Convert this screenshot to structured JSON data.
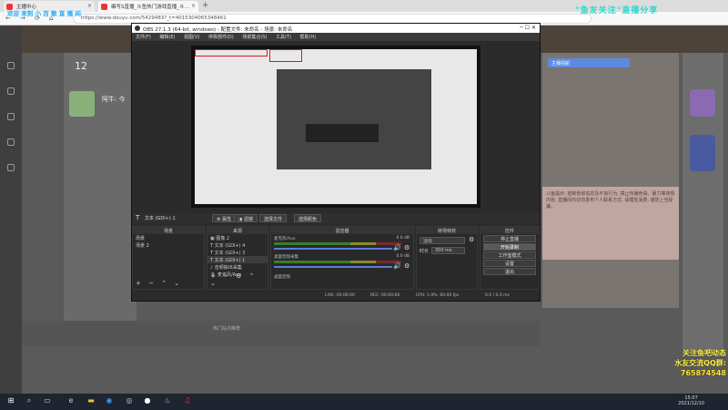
{
  "browser": {
    "tabs": [
      {
        "label": "主播中心",
        "active": false
      },
      {
        "label": "编写S直播_斗鱼热门游戏直播_斗…",
        "active": true
      }
    ],
    "url": "https://www.douyu.com/5429483?_t=4015304065348461"
  },
  "watermarks": {
    "top_left": "欢迎 来到 小 百 歌 直 播 间",
    "top_right": "\"鱼友关注\"直播分享"
  },
  "obs": {
    "title": "OBS 27.1.3 (64-bit, windows) - 配置文件: 未命名 - 场景: 未命名",
    "menu": [
      "文件(F)",
      "编辑(E)",
      "视图(V)",
      "停靠部件(D)",
      "场景集合(S)",
      "工具(T)",
      "帮助(H)"
    ],
    "source_toolbar": {
      "selected_source": "文本 (GDI+) 1",
      "buttons": [
        "属性",
        "滤镜",
        "选择文件",
        "选择颜色"
      ]
    },
    "docks": {
      "scenes": {
        "title": "场景",
        "items": [
          "场景",
          "场景 2"
        ]
      },
      "sources": {
        "title": "来源",
        "items": [
          "图像 2",
          "文本 (GDI+) 4",
          "文本 (GDI+) 3",
          "文本 (GDI+) 1",
          "音频输出采集",
          "麦克风/Aux"
        ]
      },
      "mixer": {
        "title": "混音器",
        "channels": [
          {
            "name": "麦克风/Aux",
            "db": "0.0 dB"
          },
          {
            "name": "桌面音频采集",
            "db": "0.0 dB"
          },
          {
            "name": "桌面音频",
            "db": ""
          }
        ]
      },
      "transitions": {
        "title": "转场特效",
        "type": "淡出",
        "duration_label": "时长",
        "duration": "300 ms"
      },
      "controls": {
        "title": "控件",
        "buttons": [
          "停止直播",
          "开始录制",
          "工作室模式",
          "设置",
          "退出"
        ]
      }
    },
    "status": {
      "live": "LIVE: 00:00:00",
      "rec": "REC: 00:00:00",
      "cpu": "CPU: 1.9%, 60.00 fps",
      "extra": "0.0 / 0.0 ms"
    }
  },
  "site": {
    "follow_count": "12",
    "streamer_name": "阿牛: 今",
    "right_panel_title": "主播招船",
    "pink_text": "斗鱼提示: 抵制低俗信息及不良行为, 禁止传播色情、暴力等违规内容, 直播间内切勿发布个人联系方式, 请理性消费, 谨防上当受骗。",
    "footer_notice": "热门站点推荐"
  },
  "promo": {
    "line1": "关注鱼吧动态",
    "line2": "水友交流QQ群:",
    "line3": "765874548"
  },
  "taskbar": {
    "time": "15:07",
    "date": "2021/12/10"
  },
  "colors": {
    "obs_bg": "#2b2b2b",
    "accent_red": "#e11e1e",
    "promo_yellow": "#fff44a",
    "watermark_cyan": "#2adad0"
  }
}
